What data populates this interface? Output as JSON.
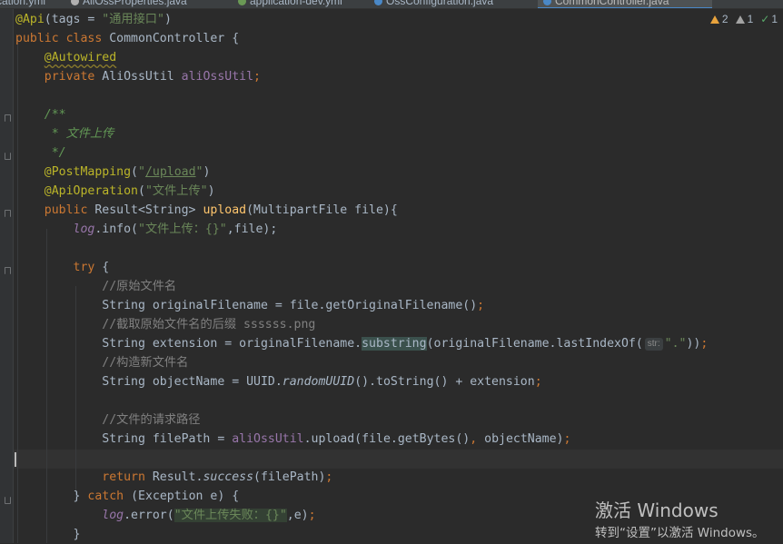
{
  "tabs": [
    {
      "label": "cation.yml",
      "icon_color": "#6b8fb5"
    },
    {
      "label": "AliOssProperties.java",
      "icon_color": "#b0b0b0"
    },
    {
      "label": "application-dev.yml",
      "icon_color": "#6a9955"
    },
    {
      "label": "OssConfiguration.java",
      "icon_color": "#4a88c7"
    },
    {
      "label": "CommonController.java",
      "icon_color": "#4a88c7"
    }
  ],
  "inspections": {
    "warnings": "2",
    "weak_warnings": "1",
    "ok": "1"
  },
  "hint_param": "str:",
  "code": {
    "l1": {
      "ann": "@Api",
      "p1": "(tags = ",
      "str": "\"通用接口\"",
      "p2": ")"
    },
    "l2": {
      "kw": "public class ",
      "name": "CommonController {"
    },
    "l3": {
      "ann": "@Autowired"
    },
    "l4": {
      "kw": "private ",
      "type": "AliOssUtil ",
      "field": "aliOssUtil",
      "semi": ";"
    },
    "l6": {
      "text": "/**"
    },
    "l7": {
      "text": " * 文件上传"
    },
    "l8": {
      "text": " */"
    },
    "l9": {
      "ann": "@PostMapping",
      "p1": "(",
      "q1": "\"",
      "url": "/upload",
      "q2": "\"",
      "p2": ")"
    },
    "l10": {
      "ann": "@ApiOperation",
      "p1": "(",
      "str": "\"文件上传\"",
      "p2": ")"
    },
    "l11": {
      "kw": "public ",
      "type": "Result<String> ",
      "method": "upload",
      "rest": "(MultipartFile file){"
    },
    "l12": {
      "log": "log",
      "rest1": ".info(",
      "str": "\"文件上传：{}\"",
      "rest2": ",file);"
    },
    "l14": {
      "kw": "try",
      "rest": " {"
    },
    "l15": {
      "comment": "//原始文件名"
    },
    "l16": {
      "pre": "String originalFilename = file.getOriginalFilename()",
      "semi": ";"
    },
    "l17": {
      "comment": "//截取原始文件名的后缀 ssssss.png"
    },
    "l18": {
      "pre": "String extension = originalFilename.",
      "hl": "substring",
      "mid": "(originalFilename.lastIndexOf(",
      "str": "\".\"",
      "post": "))",
      "semi": ";"
    },
    "l19": {
      "comment": "//构造新文件名"
    },
    "l20": {
      "pre": "String objectName = UUID.",
      "static": "randomUUID",
      "post": "().toString() + extension",
      "semi": ";"
    },
    "l22": {
      "comment": "//文件的请求路径"
    },
    "l23": {
      "pre": "String filePath = ",
      "field": "aliOssUtil",
      "post": ".upload(file.getBytes()",
      "comma": ",",
      "post2": " objectName)",
      "semi": ";"
    },
    "l25": {
      "kw": "return ",
      "pre": "Result.",
      "static": "success",
      "post": "(filePath)",
      "semi": ";"
    },
    "l26": {
      "pre": "} ",
      "kw": "catch",
      "post": " (Exception e) {"
    },
    "l27": {
      "log": "log",
      "rest1": ".error(",
      "str": "\"文件上传失败：{}\"",
      "rest2": ",e)",
      "semi": ";"
    },
    "l28": {
      "text": "}"
    }
  },
  "watermark": {
    "line1": "激活 Windows",
    "line2": "转到“设置”以激活 Windows。"
  }
}
